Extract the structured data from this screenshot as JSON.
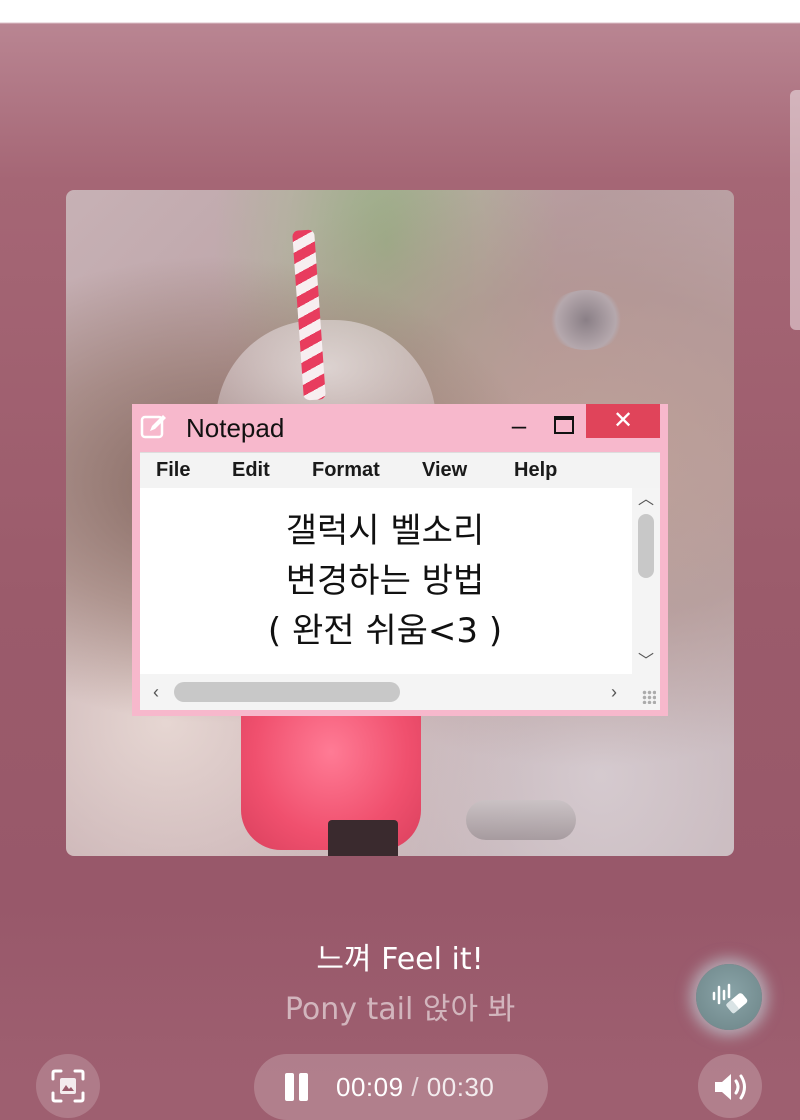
{
  "notepad": {
    "title": "Notepad",
    "menu": [
      "File",
      "Edit",
      "Format",
      "View",
      "Help"
    ],
    "lines": [
      "갤럭시 벨소리",
      "변경하는 방법",
      "( 완전 쉬움<3 )"
    ],
    "close_glyph": "✕",
    "minimize_glyph": "–"
  },
  "lyrics": {
    "current": "느껴 Feel it!",
    "next": "Pony tail 앉아 봐"
  },
  "player": {
    "elapsed": "00:09",
    "separator": "/",
    "total": "00:30",
    "state": "playing"
  },
  "colors": {
    "background": "#a56675",
    "notepad_frame": "#f7b8cc",
    "close_button": "#e0445a"
  },
  "icons": {
    "notepad": "edit-icon",
    "voice": "voice-eraser-icon",
    "scan": "image-scan-icon",
    "volume": "volume-icon",
    "pause": "pause-icon"
  }
}
